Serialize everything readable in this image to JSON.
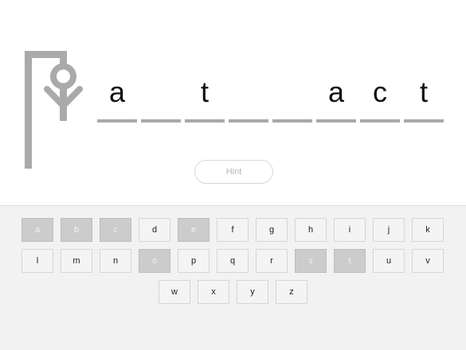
{
  "gallows": {
    "color": "#aaaaaa"
  },
  "word": {
    "slots": [
      {
        "letter": "a"
      },
      {
        "letter": ""
      },
      {
        "letter": "t"
      },
      {
        "letter": ""
      },
      {
        "letter": ""
      },
      {
        "letter": "a"
      },
      {
        "letter": "c"
      },
      {
        "letter": "t"
      }
    ]
  },
  "hint": {
    "label": "Hint"
  },
  "keyboard": {
    "rows": [
      [
        "a",
        "b",
        "c",
        "d",
        "e",
        "f",
        "g",
        "h",
        "i",
        "j",
        "k"
      ],
      [
        "l",
        "m",
        "n",
        "o",
        "p",
        "q",
        "r",
        "s",
        "t",
        "u",
        "v"
      ],
      [
        "w",
        "x",
        "y",
        "z"
      ]
    ],
    "used": [
      "a",
      "b",
      "c",
      "e",
      "o",
      "s",
      "t"
    ]
  }
}
